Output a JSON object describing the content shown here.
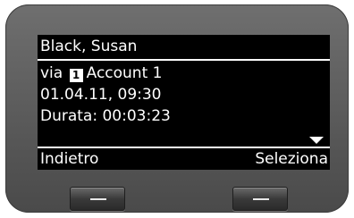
{
  "header": {
    "title": "Black, Susan"
  },
  "details": {
    "via_label": "via",
    "account_badge": "1",
    "account_name": "Account 1",
    "datetime": "01.04.11, 09:30",
    "duration": "Durata: 00:03:23"
  },
  "softkeys": {
    "left_label": "Indietro",
    "right_label": "Seleziona"
  },
  "colors": {
    "screen_bg": "#000000",
    "screen_text": "#ffffff",
    "device_body": "#5f5f5f"
  }
}
